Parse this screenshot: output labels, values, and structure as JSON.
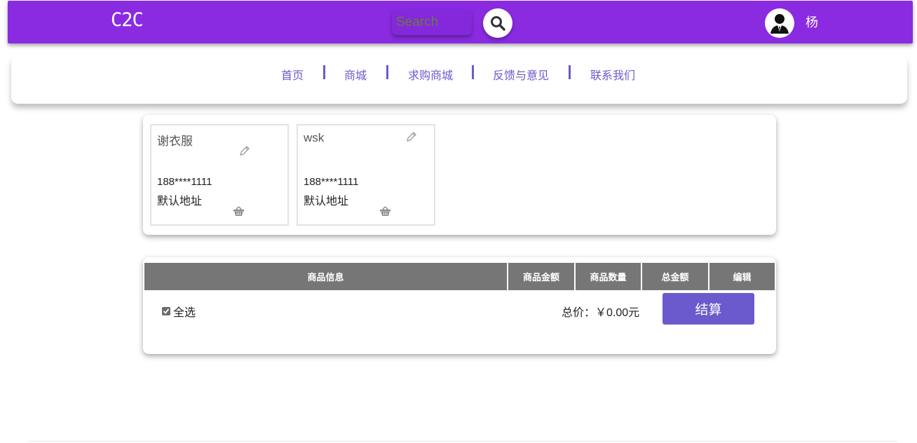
{
  "header": {
    "logo": "C2C",
    "search_placeholder": "Search",
    "username": "杨",
    "brand_color": "#8a2be2"
  },
  "nav": {
    "items": [
      "首页",
      "商城",
      "求购商城",
      "反馈与意见",
      "联系我们"
    ]
  },
  "addresses": [
    {
      "name": "谢衣服",
      "phone": "188****1111",
      "default_label": "默认地址"
    },
    {
      "name": "wsk",
      "phone": "188****1111",
      "default_label": "默认地址"
    }
  ],
  "cart": {
    "columns": [
      "商品信息",
      "商品金额",
      "商品数量",
      "总金额",
      "编辑"
    ],
    "select_all_label": "全选",
    "select_all_checked": true,
    "total_label": "总价：￥0.00元",
    "checkout_label": "结算",
    "accent_color": "#6a5acd"
  },
  "icons": {
    "search": "search-icon",
    "avatar": "user-avatar-icon",
    "edit": "pencil-icon",
    "delete": "basket-icon"
  }
}
